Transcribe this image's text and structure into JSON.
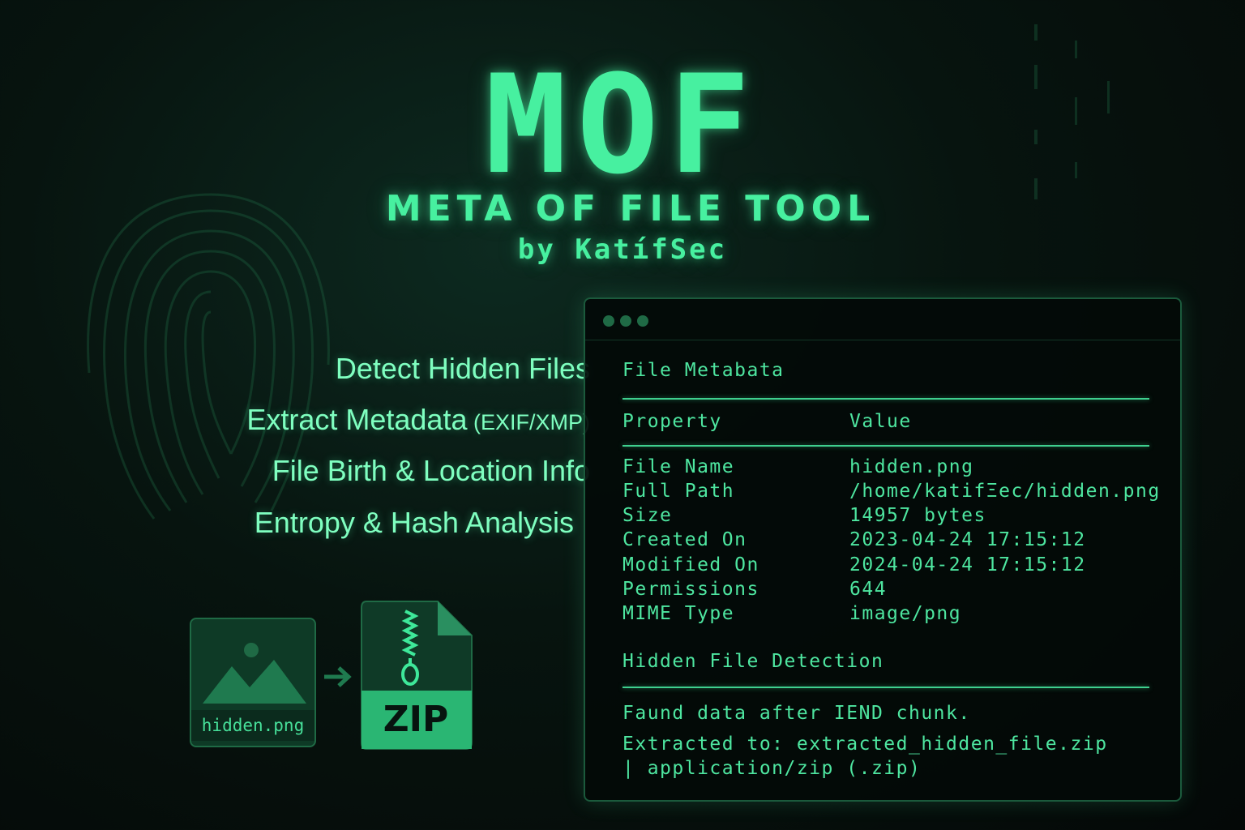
{
  "brand": {
    "logo": "MOF",
    "subtitle": "META OF FILE TOOL",
    "byline": "by KatífSec"
  },
  "features": [
    {
      "text": "Detect Hidden Files",
      "suffix": ""
    },
    {
      "text": "Extract Metadata",
      "suffix": " (EXIF/XMP)"
    },
    {
      "text": "File Birth & Location Info",
      "suffix": ""
    },
    {
      "text": "Entropy & Hash Analysis",
      "suffix": ""
    }
  ],
  "illustration": {
    "source_file": "hidden.png",
    "target_label": "ZIP"
  },
  "terminal": {
    "metadata_heading": "File Metabata",
    "columns": {
      "property": "Property",
      "value": "Value"
    },
    "rows": [
      {
        "property": "File Name",
        "value": "hidden.png"
      },
      {
        "property": "Full Path",
        "value": "/home/katifΞec/hidden.png"
      },
      {
        "property": "Size",
        "value": "14957 bytes"
      },
      {
        "property": "Created On",
        "value": "2023-04-24  17:15:12"
      },
      {
        "property": "Modified On",
        "value": "2024-04-24  17:15:12"
      },
      {
        "property": "Permissions",
        "value": "644"
      },
      {
        "property": "MIME Type",
        "value": "image/png"
      }
    ],
    "detection_heading": "Hidden File Detection",
    "detection_lines": [
      "Faund data after IEND chunk.",
      "Extracted to: extracted_hidden_file.zip",
      "| application/zip (.zip)"
    ]
  },
  "colors": {
    "accent": "#47f0a0",
    "background": "#07140f",
    "panel_border": "#1b5a3c"
  }
}
